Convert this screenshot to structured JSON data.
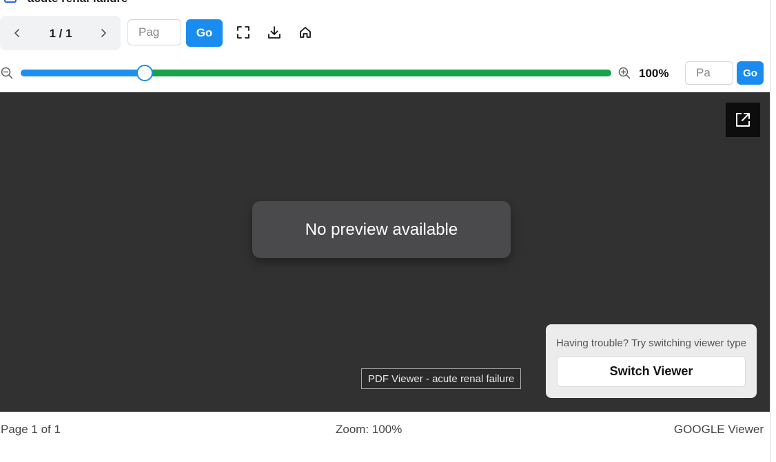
{
  "header": {
    "title": "acute renal failure"
  },
  "pager": {
    "current": "1 / 1"
  },
  "toolbar": {
    "page_placeholder": "Pag",
    "go_label": "Go"
  },
  "zoom": {
    "level_label": "100%",
    "slider_fraction": 0.21,
    "input_placeholder": "Pa",
    "go_label": "Go"
  },
  "viewer": {
    "message": "No preview available",
    "tooltip": "PDF Viewer - acute renal failure",
    "switch_hint": "Having trouble? Try switching viewer type",
    "switch_button": "Switch Viewer"
  },
  "status": {
    "page": "Page 1 of 1",
    "zoom": "Zoom: 100%",
    "viewer_type": "GOOGLE Viewer"
  },
  "colors": {
    "accent_blue": "#1a8cf0",
    "slider_rest_green": "#16a34a",
    "viewer_bg": "#313131"
  },
  "icons": [
    "chevron-left-icon",
    "chevron-right-icon",
    "fullscreen-icon",
    "download-icon",
    "home-icon",
    "zoom-out-icon",
    "zoom-in-icon",
    "external-link-icon"
  ]
}
